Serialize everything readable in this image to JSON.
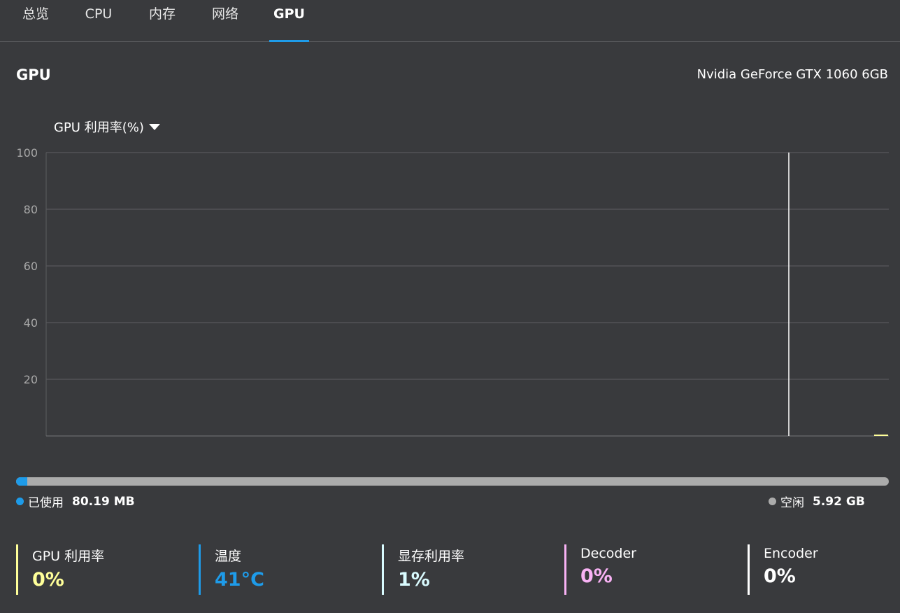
{
  "tabs": [
    {
      "label": "总览",
      "active": false
    },
    {
      "label": "CPU",
      "active": false
    },
    {
      "label": "内存",
      "active": false
    },
    {
      "label": "网络",
      "active": false
    },
    {
      "label": "GPU",
      "active": true
    }
  ],
  "section": {
    "title": "GPU",
    "model": "Nvidia GeForce GTX 1060 6GB"
  },
  "metric_selector": {
    "label": "GPU 利用率(%)",
    "icon": "caret-down-icon"
  },
  "chart_data": {
    "type": "line",
    "ylim": [
      0,
      100
    ],
    "yticks": [
      "100",
      "80",
      "60",
      "40",
      "20"
    ],
    "grid": true,
    "series": [
      {
        "color": "#ffff99",
        "values": [
          0
        ]
      }
    ],
    "cursor_line_color": "#ffffff"
  },
  "memory": {
    "used_fraction": 0.013,
    "used_label": "已使用",
    "used_value": "80.19 MB",
    "free_label": "空闲",
    "free_value": "5.92 GB",
    "used_color": "#1e9be9",
    "free_color": "#ababab"
  },
  "stats": [
    {
      "label": "GPU 利用率",
      "value": "0%",
      "color": "#ffff99"
    },
    {
      "label": "温度",
      "value": "41°C",
      "color": "#1e9be9"
    },
    {
      "label": "显存利用率",
      "value": "1%",
      "color": "#d9fbff"
    },
    {
      "label": "Decoder",
      "value": "0%",
      "color": "#f9b2f5"
    },
    {
      "label": "Encoder",
      "value": "0%",
      "color": "#ffffff"
    }
  ]
}
